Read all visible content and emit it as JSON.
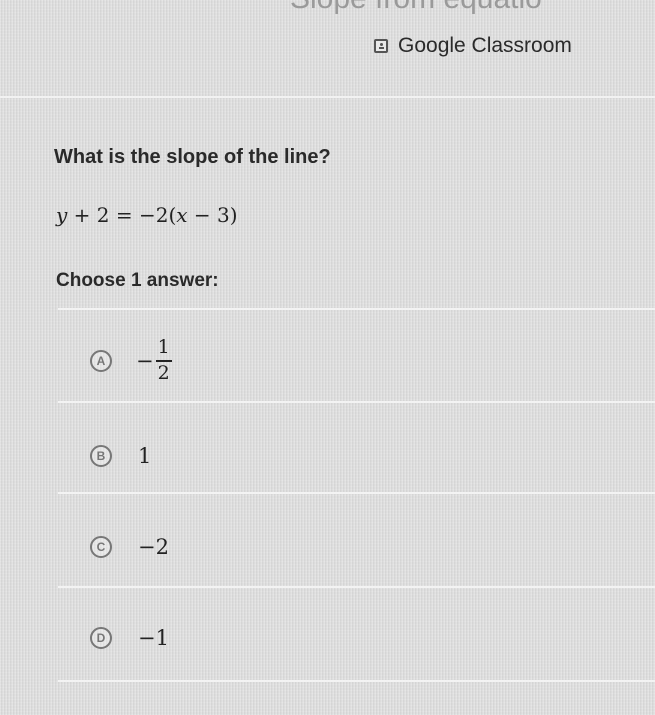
{
  "header": {
    "title_partial": "Slope from equatio",
    "classroom_label": "Google Classroom"
  },
  "question": {
    "prompt": "What is the slope of the line?",
    "equation": {
      "y": "y",
      "part1": " + 2 = −2(",
      "x": "x",
      "part2": " − 3)"
    },
    "instruction": "Choose 1 answer:"
  },
  "choices": [
    {
      "letter": "A",
      "sign": "−",
      "numerator": "1",
      "denominator": "2"
    },
    {
      "letter": "B",
      "value": "1"
    },
    {
      "letter": "C",
      "value": "−2"
    },
    {
      "letter": "D",
      "value": "−1"
    }
  ]
}
